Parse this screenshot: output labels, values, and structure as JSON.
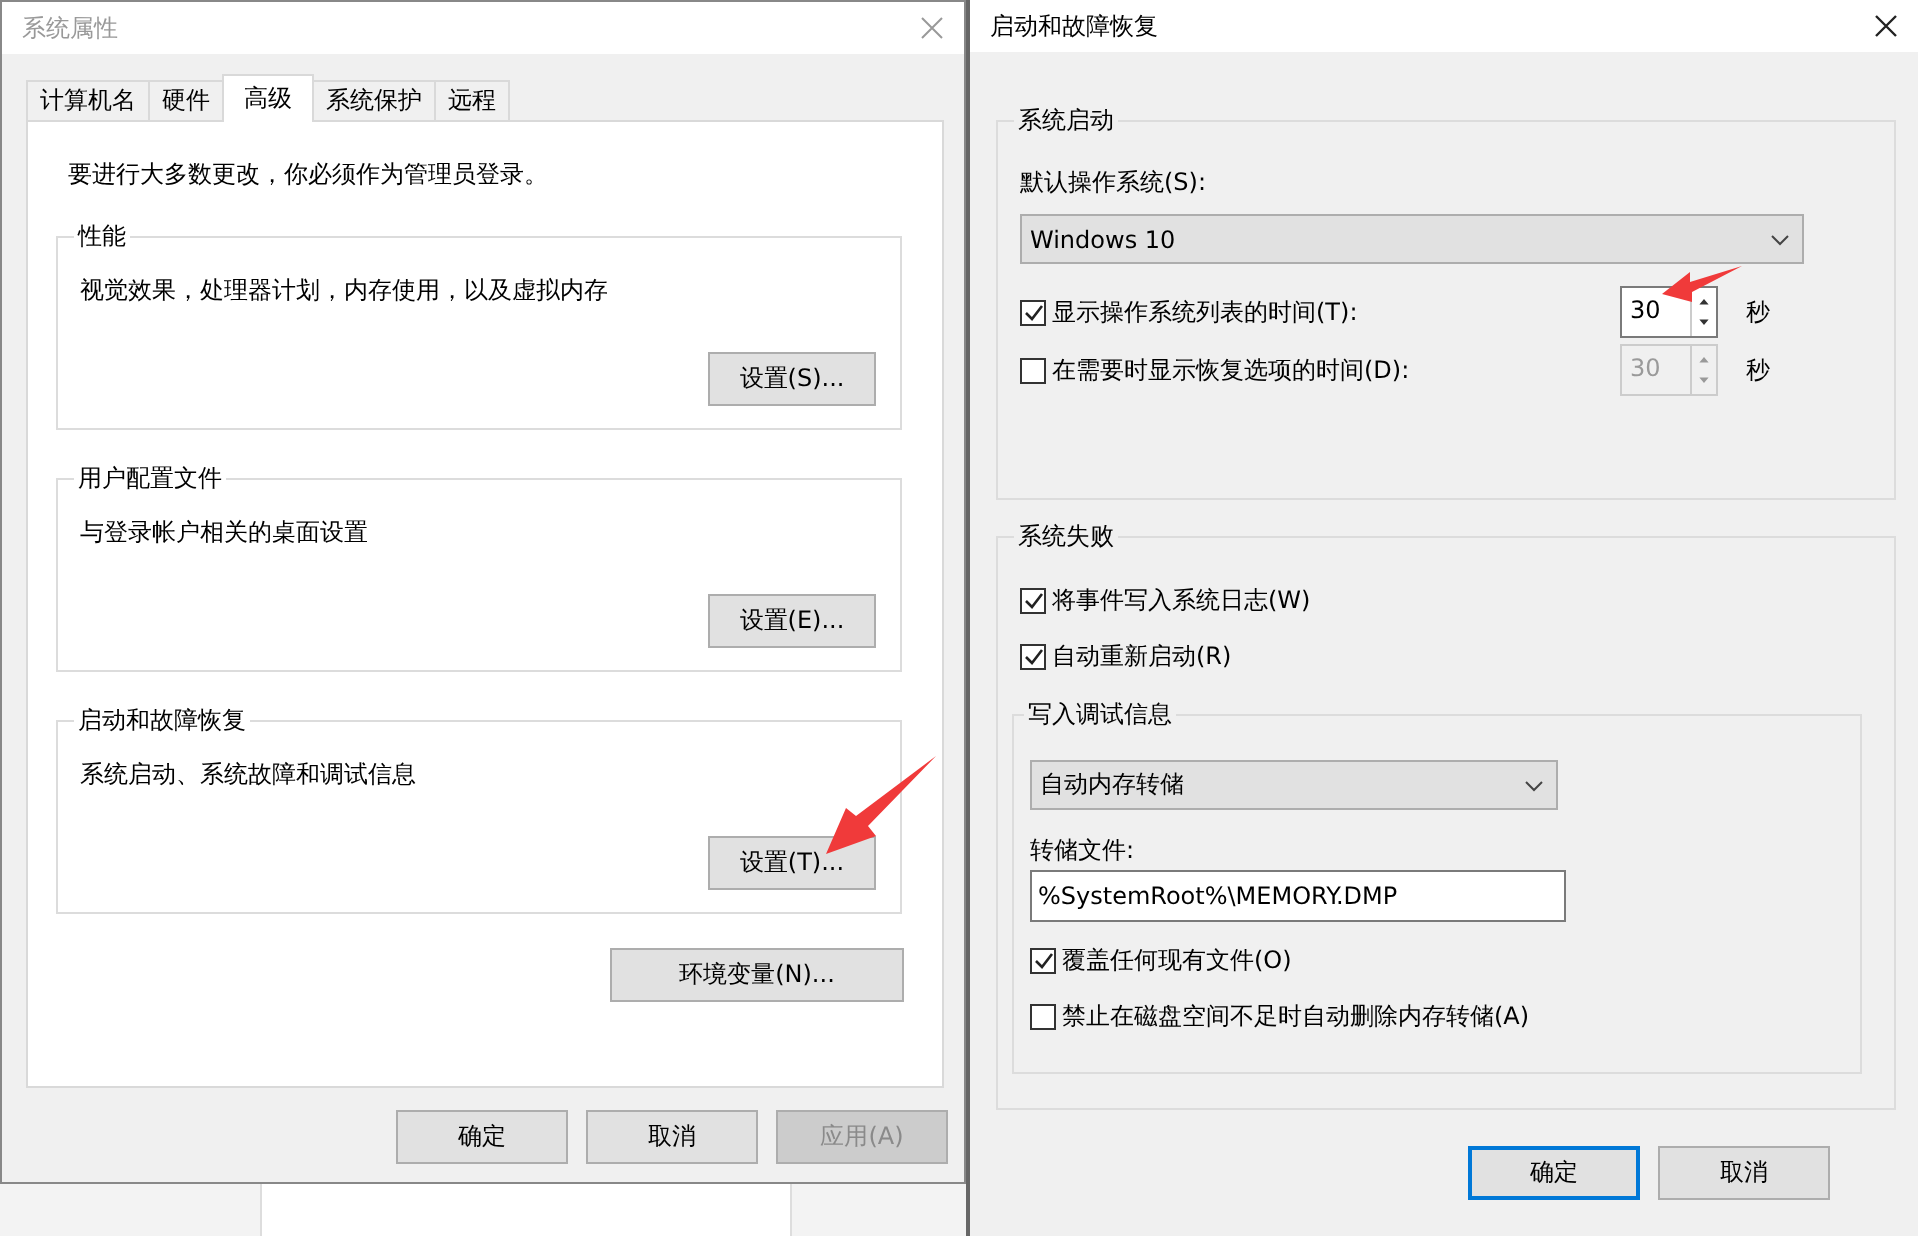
{
  "system_properties": {
    "title": "系统属性",
    "tabs": [
      {
        "label": "计算机名",
        "selected": false
      },
      {
        "label": "硬件",
        "selected": false
      },
      {
        "label": "高级",
        "selected": true
      },
      {
        "label": "系统保护",
        "selected": false
      },
      {
        "label": "远程",
        "selected": false
      }
    ],
    "notice": "要进行大多数更改，你必须作为管理员登录。",
    "groups": [
      {
        "title": "性能",
        "description": "视觉效果，处理器计划，内存使用，以及虚拟内存",
        "button": "设置(S)..."
      },
      {
        "title": "用户配置文件",
        "description": "与登录帐户相关的桌面设置",
        "button": "设置(E)..."
      },
      {
        "title": "启动和故障恢复",
        "description": "系统启动、系统故障和调试信息",
        "button": "设置(T)..."
      }
    ],
    "env_button": "环境变量(N)...",
    "buttons": [
      {
        "label": "确定",
        "disabled": false
      },
      {
        "label": "取消",
        "disabled": false
      },
      {
        "label": "应用(A)",
        "disabled": true
      }
    ]
  },
  "startup_recovery": {
    "title": "启动和故障恢复",
    "system_startup": {
      "title": "系统启动",
      "default_os_label": "默认操作系统(S):",
      "default_os": "Windows 10",
      "rows": [
        {
          "label": "显示操作系统列表的时间(T):",
          "checked": true,
          "value": "30",
          "unit": "秒"
        },
        {
          "label": "在需要时显示恢复选项的时间(D):",
          "checked": false,
          "value": "30",
          "unit": "秒"
        }
      ]
    },
    "system_failure": {
      "title": "系统失败",
      "checks": [
        {
          "label": "将事件写入系统日志(W)",
          "checked": true
        },
        {
          "label": "自动重新启动(R)",
          "checked": true
        }
      ],
      "debug": {
        "title": "写入调试信息",
        "dump_type": "自动内存转储",
        "file_label": "转储文件:",
        "file_value": "%SystemRoot%\\MEMORY.DMP",
        "checks": [
          {
            "label": "覆盖任何现有文件(O)",
            "checked": true
          },
          {
            "label": "禁止在磁盘空间不足时自动删除内存转储(A)",
            "checked": false
          }
        ]
      }
    },
    "buttons": [
      {
        "label": "确定",
        "default": true
      },
      {
        "label": "取消",
        "default": false
      }
    ]
  }
}
